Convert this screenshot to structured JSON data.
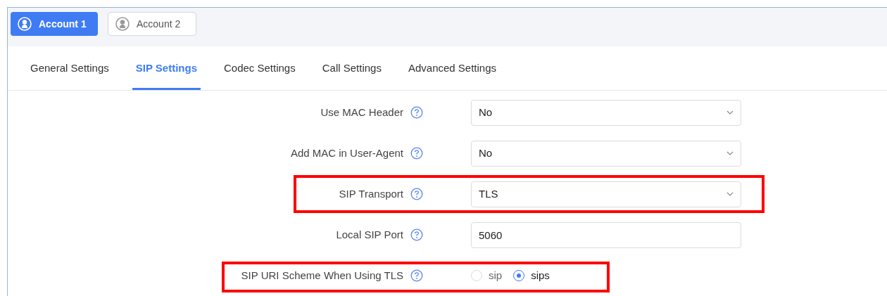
{
  "accounts": [
    {
      "label": "Account 1",
      "selected": true
    },
    {
      "label": "Account 2",
      "selected": false
    }
  ],
  "tabs": [
    {
      "label": "General Settings",
      "selected": false
    },
    {
      "label": "SIP Settings",
      "selected": true
    },
    {
      "label": "Codec Settings",
      "selected": false
    },
    {
      "label": "Call Settings",
      "selected": false
    },
    {
      "label": "Advanced Settings",
      "selected": false
    }
  ],
  "fields": [
    {
      "kind": "select",
      "label": "Use MAC Header",
      "value": "No",
      "highlighted": false
    },
    {
      "kind": "select",
      "label": "Add MAC in User-Agent",
      "value": "No",
      "highlighted": false
    },
    {
      "kind": "select",
      "label": "SIP Transport",
      "value": "TLS",
      "highlighted": true
    },
    {
      "kind": "text",
      "label": "Local SIP Port",
      "value": "5060",
      "highlighted": false
    },
    {
      "kind": "radio",
      "label": "SIP URI Scheme When Using TLS",
      "highlighted": true,
      "options": [
        {
          "label": "sip",
          "selected": false
        },
        {
          "label": "sips",
          "selected": true
        }
      ]
    }
  ]
}
